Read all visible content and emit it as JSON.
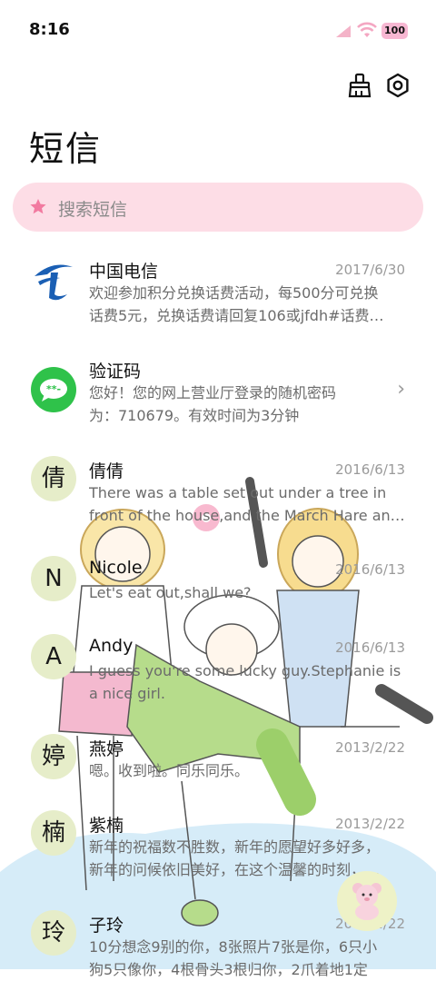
{
  "status_bar": {
    "time": "8:16",
    "battery": "100"
  },
  "header": {
    "title": "短信"
  },
  "search": {
    "placeholder": "搜索短信"
  },
  "conversations": [
    {
      "avatar": "",
      "name": "中国电信",
      "date": "2017/6/30",
      "line1": "欢迎参加积分兑换话费活动，每500分可兑换",
      "line2": "话费5元，兑换话费请回复106或jfdh#话费…"
    },
    {
      "avatar": "",
      "name": "验证码",
      "date": "",
      "line1": "您好！您的网上营业厅登录的随机密码",
      "line2": "为：710679。有效时间为3分钟"
    },
    {
      "avatar": "倩",
      "name": "倩倩",
      "date": "2016/6/13",
      "line1": "There was a table set out under a tree in",
      "line2": "front of the house,and the March Hare an…"
    },
    {
      "avatar": "N",
      "name": "Nicole",
      "date": "2016/6/13",
      "line1": "Let's eat out,shall we?",
      "line2": ""
    },
    {
      "avatar": "A",
      "name": "Andy",
      "date": "2016/6/13",
      "line1": "I guess you're some lucky guy.Stephanie is",
      "line2": "a nice girl."
    },
    {
      "avatar": "婷",
      "name": "燕婷",
      "date": "2013/2/22",
      "line1": "嗯。收到啦。同乐同乐。",
      "line2": ""
    },
    {
      "avatar": "楠",
      "name": "紫楠",
      "date": "2013/2/22",
      "line1": "新年的祝福数不胜数，新年的愿望好多好多，",
      "line2": "新年的问候依旧美好，在这个温馨的时刻，…"
    },
    {
      "avatar": "玲",
      "name": "子玲",
      "date": "2013/2/22",
      "line1": "10分想念9别的你，8张照片7张是你，6只小",
      "line2": "狗5只像你，4根骨头3根归你，2爪着地1定"
    }
  ]
}
